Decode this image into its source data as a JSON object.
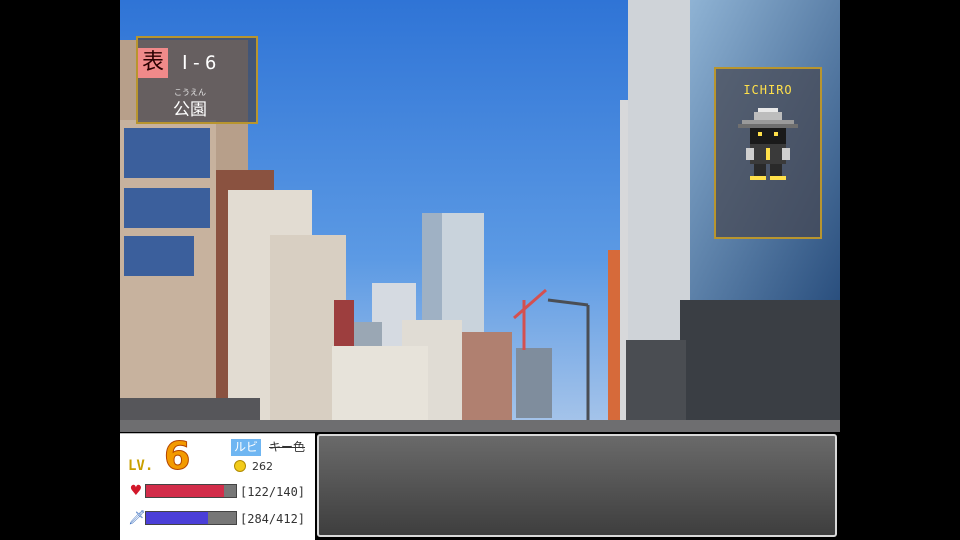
{
  "location": {
    "badge": "表",
    "code": "Ⅰ-6",
    "ruby": "こうえん",
    "name": "公園"
  },
  "character": {
    "name": "ICHIRO"
  },
  "status": {
    "level_label": "LV.",
    "level": "6",
    "tag_ruby": "ルビ",
    "tag_key": "キー色",
    "gold": "262",
    "hp_text": "[122/140]",
    "hp_fraction": 0.871,
    "mp_text": "[284/412]",
    "mp_fraction": 0.689
  },
  "message": {
    "text": ""
  },
  "colors": {
    "frame_gold": "#b8952e",
    "level_orange": "#f39a00",
    "hp_red": "#d22d4a",
    "mp_blue": "#4b3fd8",
    "ruby_tag_blue": "#6fb6f2"
  },
  "icons": {
    "hp": "heart-icon",
    "mp": "sword-icon",
    "gold": "coin-icon"
  }
}
